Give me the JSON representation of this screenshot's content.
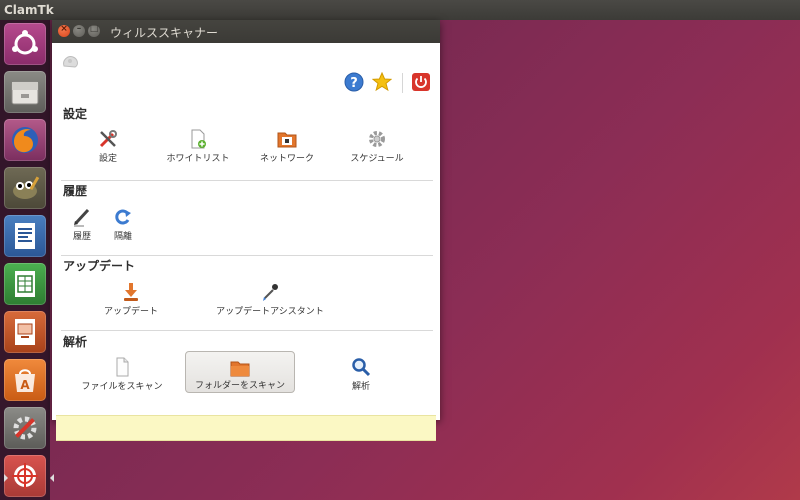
{
  "topbar": {
    "app_name": "ClamTk"
  },
  "launcher": {
    "items": [
      {
        "name": "ubuntu-dash-icon"
      },
      {
        "name": "files-icon"
      },
      {
        "name": "firefox-icon"
      },
      {
        "name": "gimp-icon"
      },
      {
        "name": "writer-icon"
      },
      {
        "name": "calc-icon"
      },
      {
        "name": "impress-icon"
      },
      {
        "name": "software-center-icon"
      },
      {
        "name": "system-settings-icon"
      },
      {
        "name": "clamtk-icon"
      }
    ]
  },
  "window": {
    "title": "ウィルススキャナー",
    "sections": {
      "settings": {
        "title": "設定",
        "items": {
          "settings": "設定",
          "whitelist": "ホワイトリスト",
          "network": "ネットワーク",
          "schedule": "スケジュール"
        }
      },
      "history": {
        "title": "履歴",
        "items": {
          "history": "履歴",
          "quarantine": "隔離"
        }
      },
      "update": {
        "title": "アップデート",
        "items": {
          "update": "アップデート",
          "update_assistant": "アップデートアシスタント"
        }
      },
      "analysis": {
        "title": "解析",
        "items": {
          "scan_file": "ファイルをスキャン",
          "scan_folder": "フォルダーをスキャン",
          "analysis": "解析"
        }
      }
    },
    "status_text": ""
  },
  "colors": {
    "close_button": "#d9441b",
    "status_bar": "#fbf8c4",
    "help_icon": "#3c7bd0",
    "power_icon": "#d8352b"
  }
}
